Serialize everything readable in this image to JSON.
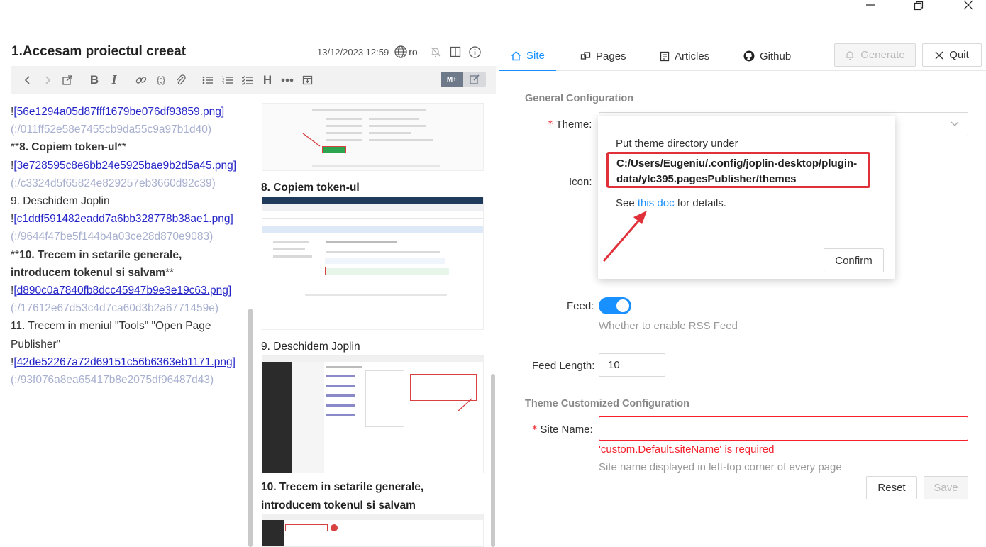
{
  "window": {
    "minimize_icon": "minimize-icon",
    "maximize_icon": "restore-icon",
    "close_icon": "close-icon"
  },
  "note": {
    "title": "1.Accesam proiectul creeat",
    "datetime": "13/12/2023 12:59",
    "lang": "ro"
  },
  "toolbar": {
    "heading_label": "H",
    "bold_label": "B",
    "italic_label": "I",
    "toggle_markdown": "M+"
  },
  "markdown": {
    "lines": [
      {
        "prefix": "!",
        "link": "[56e1294a05d87fff1679be076df93859.png]"
      },
      {
        "gray": "(:/011ff52e58e7455cb9da55c9a97b1d40)"
      },
      {
        "prefix": "**",
        "bold": "8. Copiem token-ul",
        "suffix": "**"
      },
      {
        "prefix": "!",
        "link": "[3e728595c8e6bb24e5925bae9b2d5a45.png]"
      },
      {
        "gray": "(:/c3324d5f65824e829257eb3660d92c39)"
      },
      {
        "text": "9. Deschidem Joplin"
      },
      {
        "prefix": "!",
        "link": "[c1ddf591482eadd7a6bb328778b38ae1.png]"
      },
      {
        "gray": "(:/9644f47be5f144b4a03ce28d870e9083)"
      },
      {
        "prefix": "**",
        "bold": "10. Trecem in setarile generale,"
      },
      {
        "bold": "introducem tokenul si salvam",
        "suffix": "**"
      },
      {
        "prefix": "!",
        "link": "[d890c0a7840fb8dcc45947b9e3e19c63.png]"
      },
      {
        "gray": "(:/17612e67d53c4d7ca60d3b2a6771459e)"
      },
      {
        "text": "11. Trecem in meniul \"Tools\" \"Open Page"
      },
      {
        "text": "Publisher\""
      },
      {
        "prefix": "!",
        "link": "[42de52267a72d69151c56b6363eb1171.png]"
      },
      {
        "gray": "(:/93f076a8ea65417b8e2075df96487d43)"
      }
    ]
  },
  "preview": {
    "h8": "8. Copiem token-ul",
    "h9": "9. Deschidem Joplin",
    "h10a": "10. Trecem in setarile generale,",
    "h10b": "introducem tokenul si salvam"
  },
  "tabs": [
    {
      "label": "Site",
      "icon": "home-icon",
      "active": true
    },
    {
      "label": "Pages",
      "icon": "pages-icon",
      "active": false
    },
    {
      "label": "Articles",
      "icon": "article-icon",
      "active": false
    },
    {
      "label": "Github",
      "icon": "github-icon",
      "active": false
    }
  ],
  "actions": {
    "generate": "Generate",
    "quit": "Quit"
  },
  "general": {
    "section": "General Configuration",
    "theme_label": "Theme",
    "icon_label": "Icon",
    "feed_label": "Feed",
    "feed_hint": "Whether to enable RSS Feed",
    "feed_enabled": true,
    "feed_length_label": "Feed Length",
    "feed_length_value": "10",
    "colon": ":"
  },
  "theme_custom": {
    "section": "Theme Customized Configuration",
    "site_name_label": "Site Name",
    "site_name_value": "",
    "site_name_error": "'custom.Default.siteName' is required",
    "site_name_hint": "Site name displayed in left-top corner of every page",
    "reset": "Reset",
    "save": "Save"
  },
  "popover": {
    "line1": "Put theme directory under",
    "path": "C:/Users/Eugeniu/.config/joplin-desktop/plugin-data/ylc395.pagesPublisher/themes",
    "see": "See",
    "link": "this doc",
    "details": "for details.",
    "confirm": "Confirm"
  },
  "colors": {
    "accent": "#1890ff",
    "error": "#f5222d",
    "annotation": "#e0303a"
  }
}
